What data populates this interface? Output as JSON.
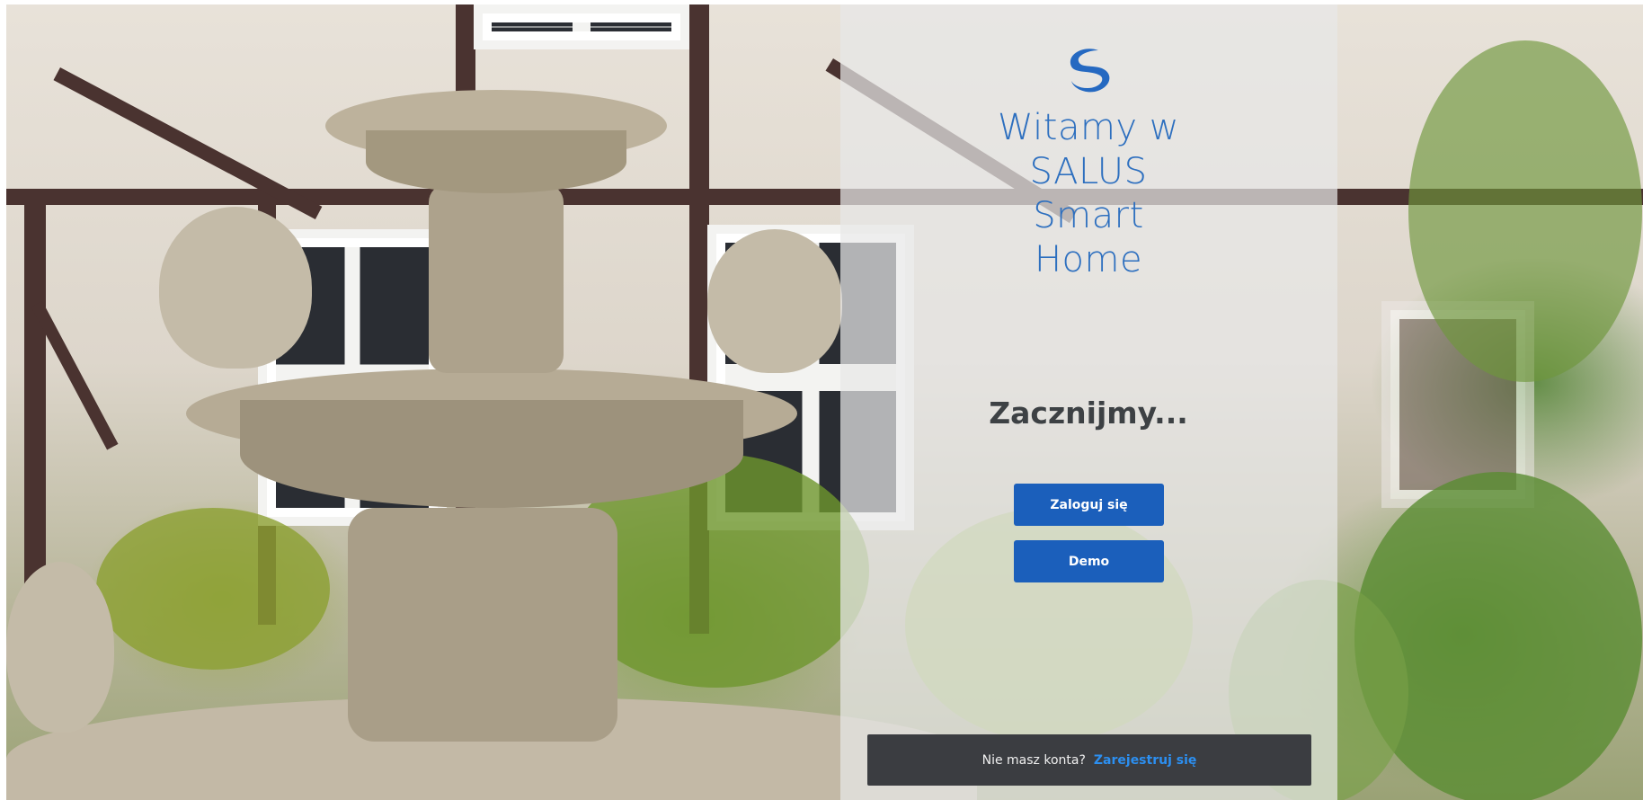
{
  "welcome": {
    "logo_icon": "salus-logo-icon",
    "lines": [
      "Witamy w",
      "SALUS",
      "Smart",
      "Home"
    ]
  },
  "main": {
    "subtitle": "Zacznijmy...",
    "login_label": "Zaloguj się",
    "demo_label": "Demo"
  },
  "footer": {
    "no_account_text": "Nie masz konta?",
    "register_link": "Zarejestruj się"
  },
  "colors": {
    "accent": "#1b5fbb",
    "title_blue": "#2d6fbf",
    "footer_bg": "#3b3d41",
    "link_blue": "#2c8ff0"
  }
}
